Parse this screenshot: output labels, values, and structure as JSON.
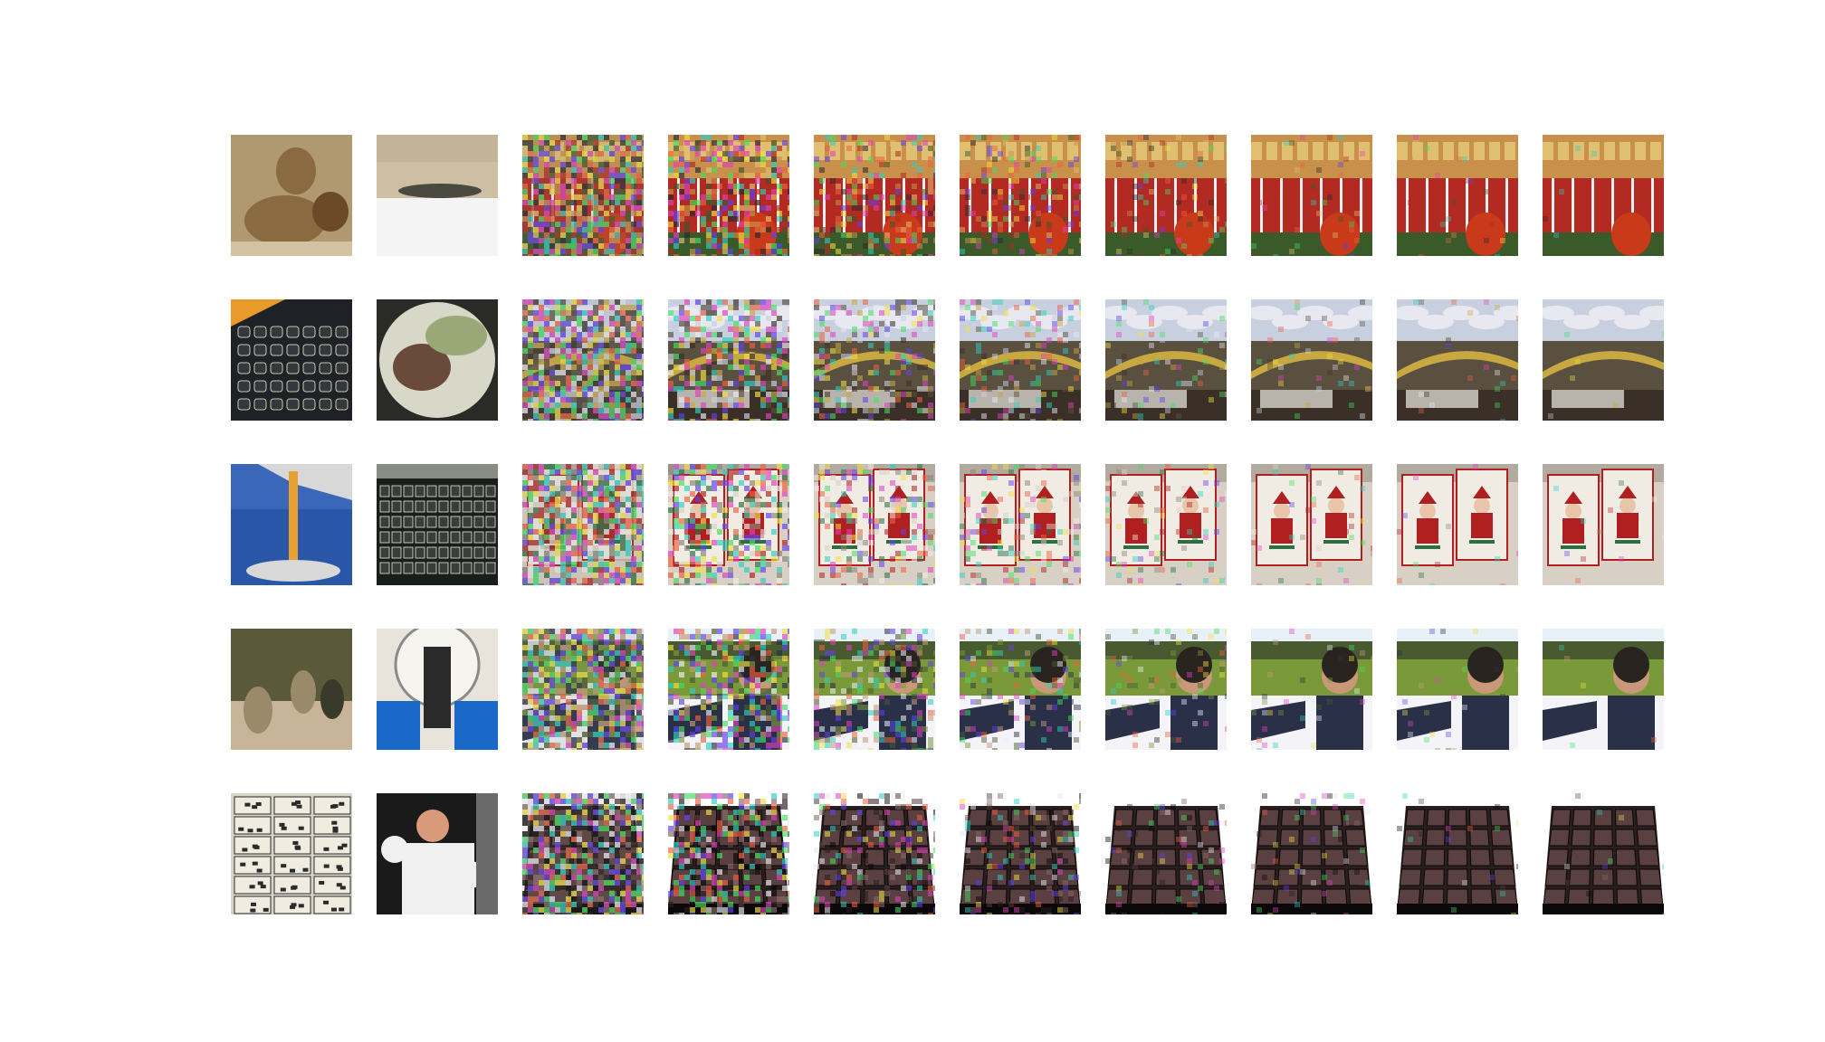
{
  "figure": {
    "background": "#ffffff",
    "rows": [
      {
        "tiles": [
          {
            "scene": "lions",
            "palette": [
              "#b09870",
              "#8a6a40",
              "#d2c2a2",
              "#6b4a2a"
            ]
          },
          {
            "scene": "alligator-on-sand",
            "palette": [
              "#cdbfa3",
              "#f4f4f4",
              "#4a4a40",
              "#b9ad93"
            ]
          },
          {
            "scene": "noisy-market",
            "level": 0.18,
            "palette": [
              "#c8904a",
              "#b22a22",
              "#3a5a2a",
              "#e0c070",
              "#2a2a30"
            ]
          },
          {
            "scene": "noisy-market",
            "level": 0.42,
            "palette": [
              "#c8904a",
              "#b22a22",
              "#3a5a2a",
              "#e0c070",
              "#2a2a30"
            ]
          },
          {
            "scene": "noisy-market",
            "level": 0.62,
            "palette": [
              "#c8904a",
              "#b22a22",
              "#3a5a2a",
              "#e0c070",
              "#2a2a30"
            ]
          },
          {
            "scene": "noisy-market",
            "level": 0.75,
            "palette": [
              "#c8904a",
              "#b22a22",
              "#3a5a2a",
              "#e0c070",
              "#2a2a30"
            ]
          },
          {
            "scene": "noisy-market",
            "level": 0.86,
            "palette": [
              "#c8904a",
              "#b22a22",
              "#3a5a2a",
              "#e0c070",
              "#2a2a30"
            ]
          },
          {
            "scene": "noisy-market",
            "level": 0.92,
            "palette": [
              "#c8904a",
              "#b22a22",
              "#3a5a2a",
              "#e0c070",
              "#2a2a30"
            ]
          },
          {
            "scene": "noisy-market",
            "level": 0.96,
            "palette": [
              "#c8904a",
              "#b22a22",
              "#3a5a2a",
              "#e0c070",
              "#2a2a30"
            ]
          },
          {
            "scene": "noisy-market",
            "level": 0.98,
            "palette": [
              "#c8904a",
              "#b22a22",
              "#3a5a2a",
              "#e0c070",
              "#2a2a30"
            ]
          }
        ]
      },
      {
        "tiles": [
          {
            "scene": "keyboard-orange",
            "palette": [
              "#1e2226",
              "#e89a2a",
              "#c8c8b0",
              "#34383c"
            ]
          },
          {
            "scene": "food-plate",
            "palette": [
              "#2a2a26",
              "#d8d8c8",
              "#6a4a3a",
              "#9aa878"
            ]
          },
          {
            "scene": "noisy-bridge",
            "level": 0.15,
            "palette": [
              "#c8d0e0",
              "#5a5040",
              "#c8a840",
              "#e8e8f0",
              "#3a3028"
            ]
          },
          {
            "scene": "noisy-bridge",
            "level": 0.42,
            "palette": [
              "#c8d0e0",
              "#5a5040",
              "#c8a840",
              "#e8e8f0",
              "#3a3028"
            ]
          },
          {
            "scene": "noisy-bridge",
            "level": 0.62,
            "palette": [
              "#c8d0e0",
              "#5a5040",
              "#c8a840",
              "#e8e8f0",
              "#3a3028"
            ]
          },
          {
            "scene": "noisy-bridge",
            "level": 0.75,
            "palette": [
              "#c8d0e0",
              "#5a5040",
              "#c8a840",
              "#e8e8f0",
              "#3a3028"
            ]
          },
          {
            "scene": "noisy-bridge",
            "level": 0.86,
            "palette": [
              "#c8d0e0",
              "#5a5040",
              "#c8a840",
              "#e8e8f0",
              "#3a3028"
            ]
          },
          {
            "scene": "noisy-bridge",
            "level": 0.92,
            "palette": [
              "#c8d0e0",
              "#5a5040",
              "#c8a840",
              "#e8e8f0",
              "#3a3028"
            ]
          },
          {
            "scene": "noisy-bridge",
            "level": 0.96,
            "palette": [
              "#c8d0e0",
              "#5a5040",
              "#c8a840",
              "#e8e8f0",
              "#3a3028"
            ]
          },
          {
            "scene": "noisy-bridge",
            "level": 0.98,
            "palette": [
              "#c8d0e0",
              "#5a5040",
              "#c8a840",
              "#e8e8f0",
              "#3a3028"
            ]
          }
        ]
      },
      {
        "tiles": [
          {
            "scene": "plunger-sky",
            "palette": [
              "#2a56a8",
              "#e8a030",
              "#d8d8d8",
              "#4a78c8"
            ]
          },
          {
            "scene": "keyboard-dark",
            "palette": [
              "#1a1e1a",
              "#e8e8e0",
              "#3a3e3a",
              "#888c84"
            ]
          },
          {
            "scene": "noisy-santa",
            "level": 0.15,
            "palette": [
              "#d8d0c4",
              "#b02020",
              "#2a7040",
              "#f0ece4",
              "#8a8478"
            ]
          },
          {
            "scene": "noisy-santa",
            "level": 0.42,
            "palette": [
              "#d8d0c4",
              "#b02020",
              "#2a7040",
              "#f0ece4",
              "#8a8478"
            ]
          },
          {
            "scene": "noisy-santa",
            "level": 0.62,
            "palette": [
              "#d8d0c4",
              "#b02020",
              "#2a7040",
              "#f0ece4",
              "#8a8478"
            ]
          },
          {
            "scene": "noisy-santa",
            "level": 0.75,
            "palette": [
              "#d8d0c4",
              "#b02020",
              "#2a7040",
              "#f0ece4",
              "#8a8478"
            ]
          },
          {
            "scene": "noisy-santa",
            "level": 0.86,
            "palette": [
              "#d8d0c4",
              "#b02020",
              "#2a7040",
              "#f0ece4",
              "#8a8478"
            ]
          },
          {
            "scene": "noisy-santa",
            "level": 0.92,
            "palette": [
              "#d8d0c4",
              "#b02020",
              "#2a7040",
              "#f0ece4",
              "#8a8478"
            ]
          },
          {
            "scene": "noisy-santa",
            "level": 0.96,
            "palette": [
              "#d8d0c4",
              "#b02020",
              "#2a7040",
              "#f0ece4",
              "#8a8478"
            ]
          },
          {
            "scene": "noisy-santa",
            "level": 0.98,
            "palette": [
              "#d8d0c4",
              "#b02020",
              "#2a7040",
              "#f0ece4",
              "#8a8478"
            ]
          }
        ]
      },
      {
        "tiles": [
          {
            "scene": "baboons",
            "palette": [
              "#9a8a6a",
              "#5a5a3a",
              "#c8b498",
              "#3a3a2a"
            ]
          },
          {
            "scene": "exercise-bike",
            "palette": [
              "#e8e4dc",
              "#1a68c8",
              "#2a2a2a",
              "#8a8a8a"
            ]
          },
          {
            "scene": "noisy-child",
            "level": 0.15,
            "palette": [
              "#7a9a3a",
              "#2a3048",
              "#e8f0f8",
              "#c89878",
              "#4a5a30"
            ]
          },
          {
            "scene": "noisy-child",
            "level": 0.42,
            "palette": [
              "#7a9a3a",
              "#2a3048",
              "#e8f0f8",
              "#c89878",
              "#4a5a30"
            ]
          },
          {
            "scene": "noisy-child",
            "level": 0.62,
            "palette": [
              "#7a9a3a",
              "#2a3048",
              "#e8f0f8",
              "#c89878",
              "#4a5a30"
            ]
          },
          {
            "scene": "noisy-child",
            "level": 0.75,
            "palette": [
              "#7a9a3a",
              "#2a3048",
              "#e8f0f8",
              "#c89878",
              "#4a5a30"
            ]
          },
          {
            "scene": "noisy-child",
            "level": 0.86,
            "palette": [
              "#7a9a3a",
              "#2a3048",
              "#e8f0f8",
              "#c89878",
              "#4a5a30"
            ]
          },
          {
            "scene": "noisy-child",
            "level": 0.92,
            "palette": [
              "#7a9a3a",
              "#2a3048",
              "#e8f0f8",
              "#c89878",
              "#4a5a30"
            ]
          },
          {
            "scene": "noisy-child",
            "level": 0.96,
            "palette": [
              "#7a9a3a",
              "#2a3048",
              "#e8f0f8",
              "#c89878",
              "#4a5a30"
            ]
          },
          {
            "scene": "noisy-child",
            "level": 0.98,
            "palette": [
              "#7a9a3a",
              "#2a3048",
              "#e8f0f8",
              "#c89878",
              "#4a5a30"
            ]
          }
        ]
      },
      {
        "tiles": [
          {
            "scene": "comic-page",
            "palette": [
              "#d8d4c8",
              "#2a2a2a",
              "#a8a49a",
              "#f0ece0"
            ]
          },
          {
            "scene": "boxer",
            "palette": [
              "#1a1a1a",
              "#f0f0f0",
              "#d89a78",
              "#6a6a6a"
            ]
          },
          {
            "scene": "noisy-keys",
            "level": 0.15,
            "palette": [
              "#2a1e1e",
              "#5a4040",
              "#e8e8f0",
              "#0a0808",
              "#8a6a6a"
            ]
          },
          {
            "scene": "noisy-keys",
            "level": 0.42,
            "palette": [
              "#2a1e1e",
              "#5a4040",
              "#e8e8f0",
              "#0a0808",
              "#8a6a6a"
            ]
          },
          {
            "scene": "noisy-keys",
            "level": 0.62,
            "palette": [
              "#2a1e1e",
              "#5a4040",
              "#e8e8f0",
              "#0a0808",
              "#8a6a6a"
            ]
          },
          {
            "scene": "noisy-keys",
            "level": 0.75,
            "palette": [
              "#2a1e1e",
              "#5a4040",
              "#e8e8f0",
              "#0a0808",
              "#8a6a6a"
            ]
          },
          {
            "scene": "noisy-keys",
            "level": 0.86,
            "palette": [
              "#2a1e1e",
              "#5a4040",
              "#e8e8f0",
              "#0a0808",
              "#8a6a6a"
            ]
          },
          {
            "scene": "noisy-keys",
            "level": 0.92,
            "palette": [
              "#2a1e1e",
              "#5a4040",
              "#e8e8f0",
              "#0a0808",
              "#8a6a6a"
            ]
          },
          {
            "scene": "noisy-keys",
            "level": 0.96,
            "palette": [
              "#2a1e1e",
              "#5a4040",
              "#e8e8f0",
              "#0a0808",
              "#8a6a6a"
            ]
          },
          {
            "scene": "noisy-keys",
            "level": 0.98,
            "palette": [
              "#2a1e1e",
              "#5a4040",
              "#e8e8f0",
              "#0a0808",
              "#8a6a6a"
            ]
          }
        ]
      }
    ]
  }
}
